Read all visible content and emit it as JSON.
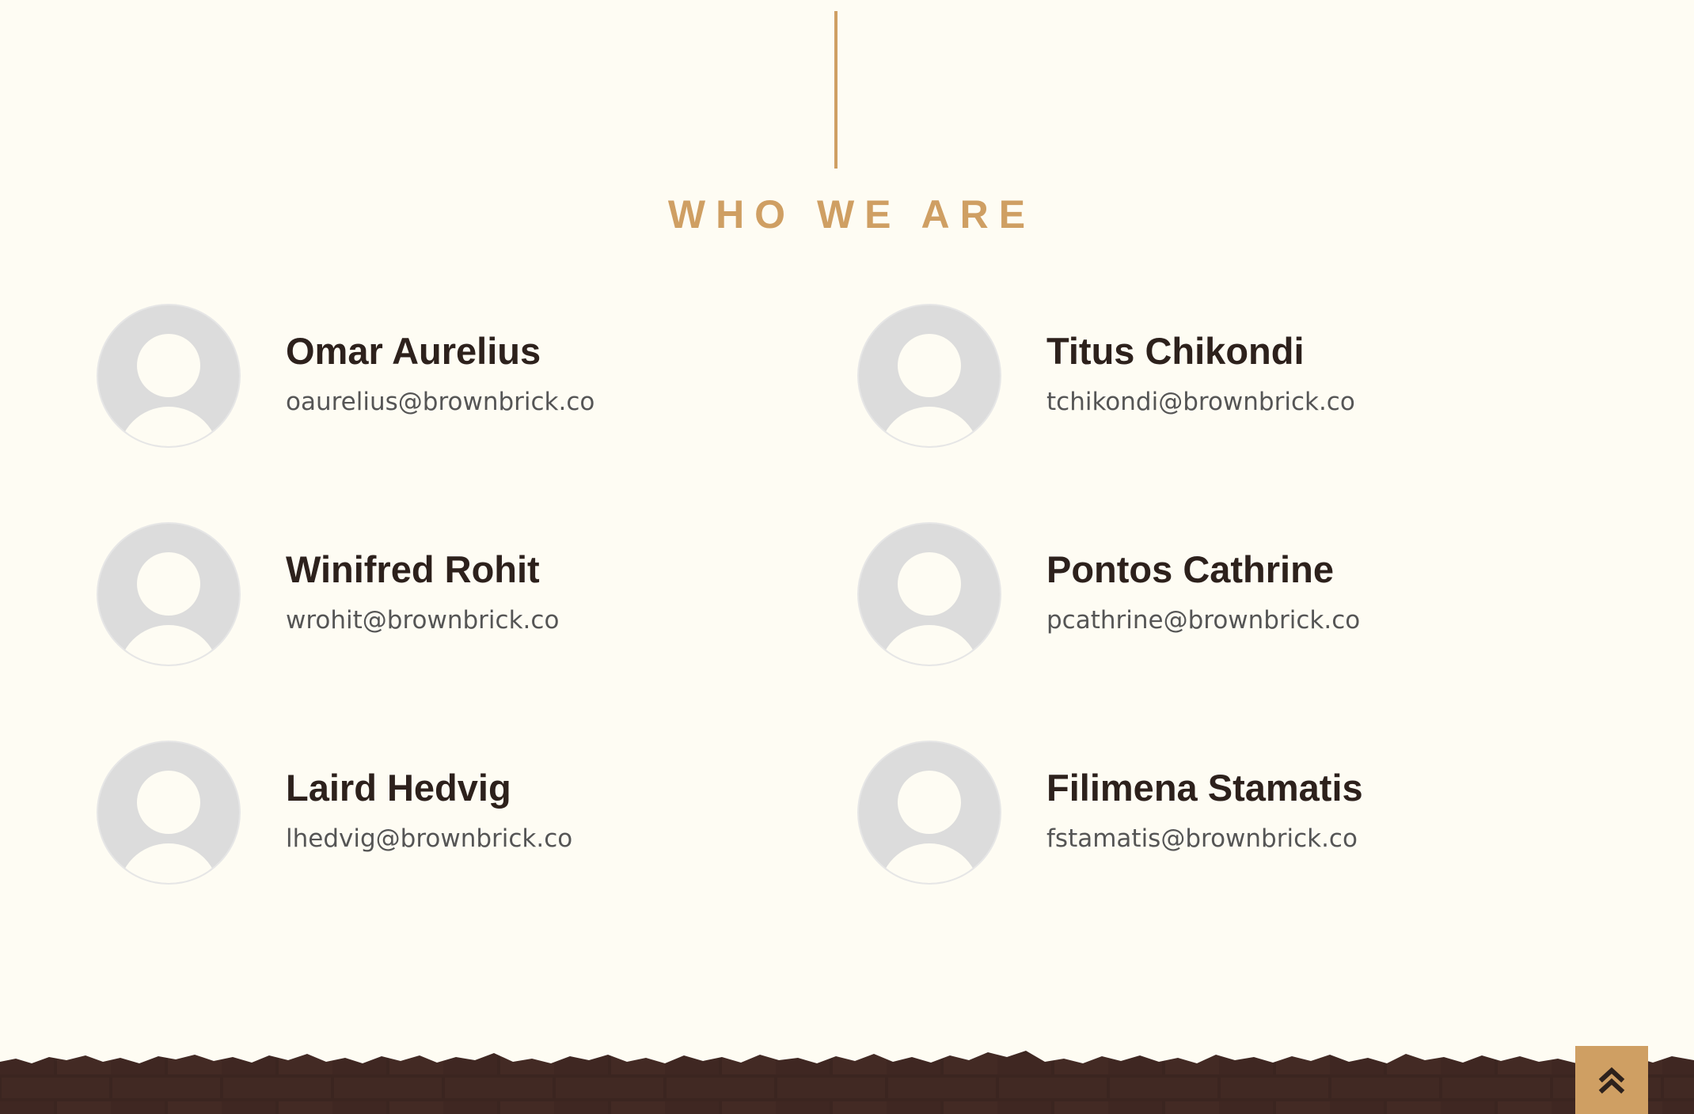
{
  "section": {
    "title": "WHO WE ARE"
  },
  "team": [
    {
      "name": "Omar Aurelius",
      "email": "oaurelius@brownbrick.co"
    },
    {
      "name": "Titus Chikondi",
      "email": "tchikondi@brownbrick.co"
    },
    {
      "name": "Winifred Rohit",
      "email": "wrohit@brownbrick.co"
    },
    {
      "name": "Pontos Cathrine",
      "email": "pcathrine@brownbrick.co"
    },
    {
      "name": "Laird Hedvig",
      "email": "lhedvig@brownbrick.co"
    },
    {
      "name": "Filimena Stamatis",
      "email": "fstamatis@brownbrick.co"
    }
  ],
  "icons": {
    "avatar": "default-user-avatar-icon",
    "back_to_top": "double-chevron-up-icon"
  },
  "colors": {
    "background": "#fefcf3",
    "accent": "#cf9f63",
    "heading_text": "#2d211c",
    "email_text": "#555555",
    "footer_brick": "#3b2520"
  }
}
